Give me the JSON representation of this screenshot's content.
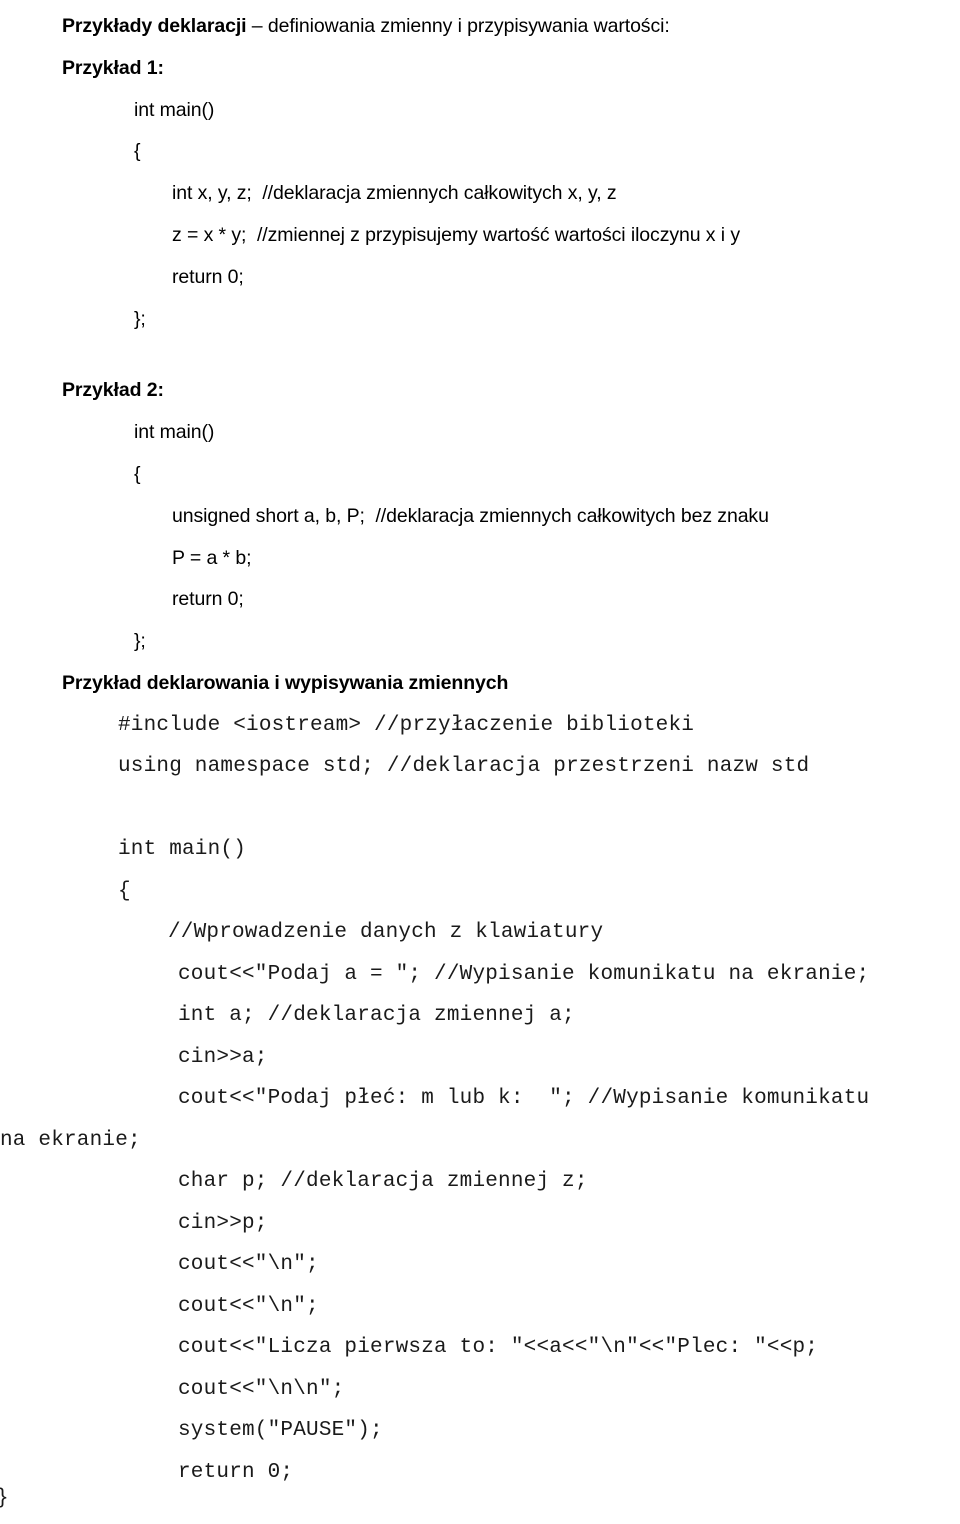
{
  "document": {
    "title_bold": "Przykłady deklaracji",
    "title_rest": " – definiowania zmienny i przypisywania wartości:",
    "example1": {
      "heading": "Przykład 1:",
      "lines": [
        {
          "text": "int main()",
          "indent": 1
        },
        {
          "text": "{",
          "indent": 1
        },
        {
          "text": "int x, y, z;  //deklaracja zmiennych całkowitych x, y, z",
          "indent": 2
        },
        {
          "text": "z = x * y;  //zmiennej z przypisujemy wartość wartości iloczynu x i y",
          "indent": 2
        },
        {
          "text": "return 0;",
          "indent": 2
        },
        {
          "text": "};",
          "indent": 1
        }
      ]
    },
    "example2": {
      "heading": "Przykład 2:",
      "lines": [
        {
          "text": "int main()",
          "indent": 1
        },
        {
          "text": "{",
          "indent": 1
        },
        {
          "text": "unsigned short a, b, P;  //deklaracja zmiennych całkowitych bez znaku",
          "indent": 2
        },
        {
          "text": "P = a * b;",
          "indent": 2
        },
        {
          "text": "return 0;",
          "indent": 2
        },
        {
          "text": "};",
          "indent": 1
        }
      ]
    },
    "example3": {
      "heading": "Przykład deklarowania i wypisywania zmiennych",
      "lines": [
        {
          "text": "#include <iostream> //przyłaczenie biblioteki",
          "indent": 1
        },
        {
          "text": "using namespace std; //deklaracja przestrzeni nazw std",
          "indent": 1
        },
        {
          "text": "",
          "indent": 0
        },
        {
          "text": "int main()",
          "indent": 1
        },
        {
          "text": "{",
          "indent": 1
        },
        {
          "text": "//Wprowadzenie danych z klawiatury",
          "indent": 2
        },
        {
          "text": "cout<<\"Podaj a = \"; //Wypisanie komunikatu na ekranie;",
          "indent": 3
        },
        {
          "text": "int a; //deklaracja zmiennej a;",
          "indent": 3
        },
        {
          "text": "cin>>a;",
          "indent": 3
        },
        {
          "text": "cout<<\"Podaj płeć: m lub k:  \"; //Wypisanie komunikatu",
          "indent": 3
        },
        {
          "text": "na ekranie;",
          "indent": 0
        },
        {
          "text": "char p; //deklaracja zmiennej z;",
          "indent": 3
        },
        {
          "text": "cin>>p;",
          "indent": 3
        },
        {
          "text": "cout<<\"\\n\";",
          "indent": 3
        },
        {
          "text": "cout<<\"\\n\";",
          "indent": 3
        },
        {
          "text": "cout<<\"Licza pierwsza to: \"<<a<<\"\\n\"<<\"Plec: \"<<p;",
          "indent": 3
        },
        {
          "text": "cout<<\"\\n\\n\";",
          "indent": 3
        },
        {
          "text": "system(\"PAUSE\");",
          "indent": 3
        },
        {
          "text": "return 0;",
          "indent": 3
        }
      ],
      "closing_brace": "}"
    }
  }
}
